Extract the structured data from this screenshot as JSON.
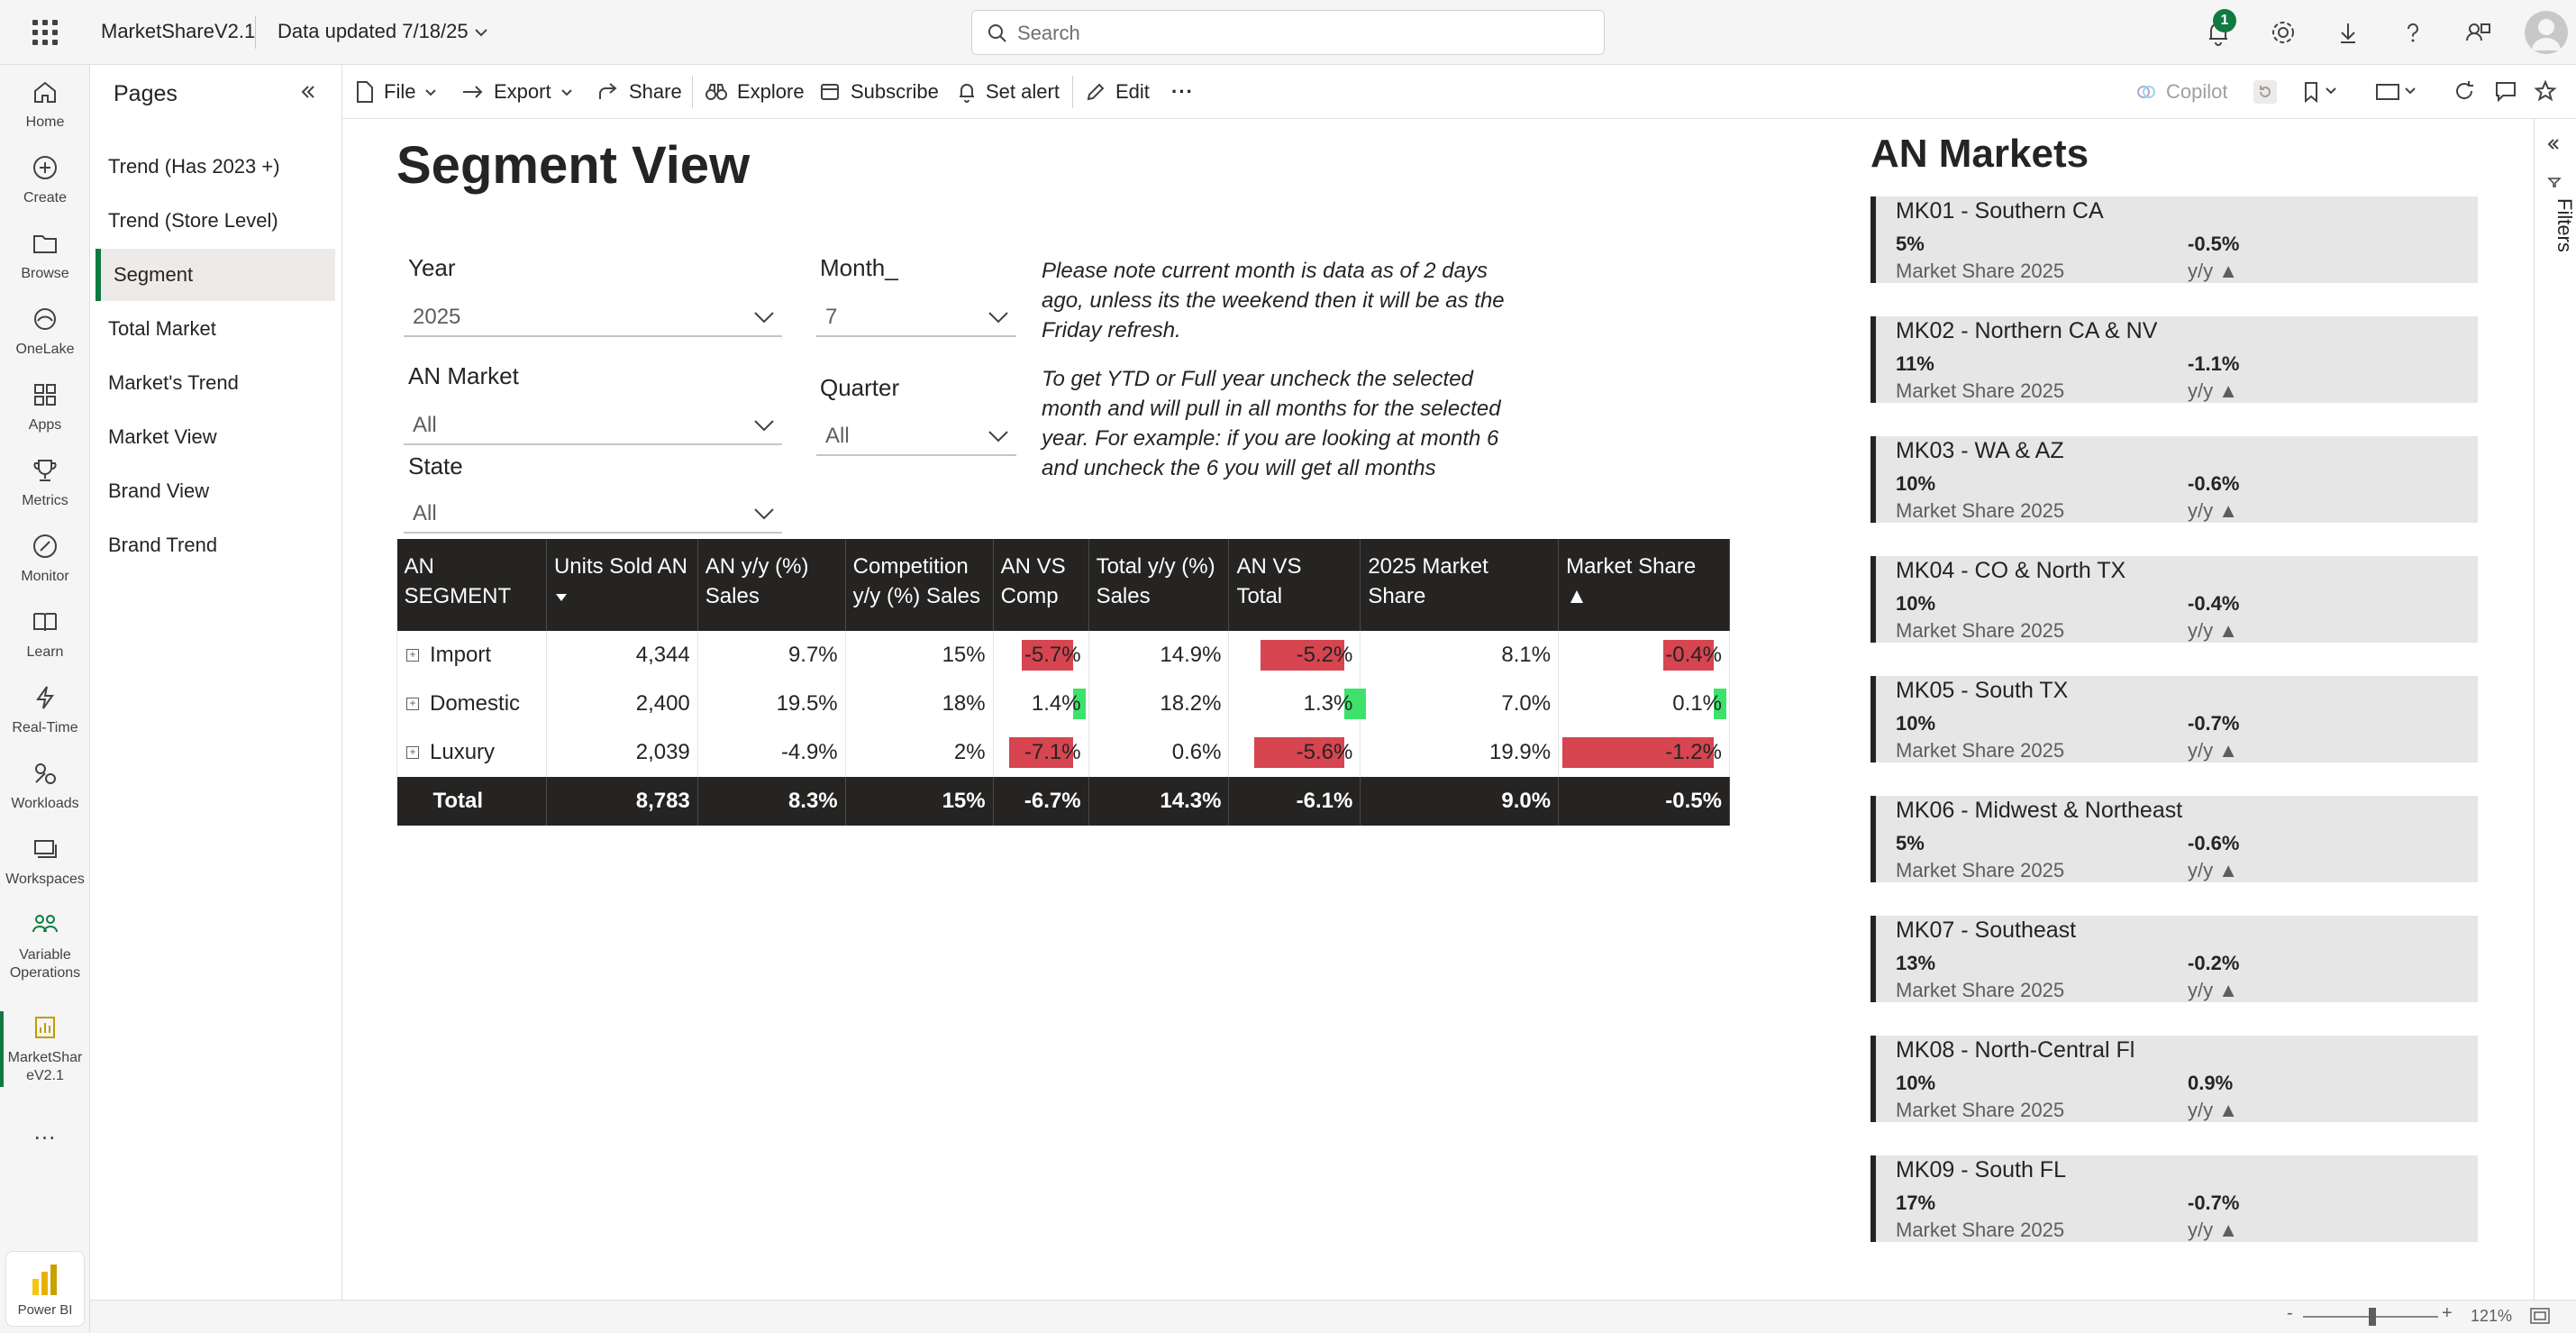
{
  "header": {
    "app_name": "MarketShareV2.1",
    "data_updated": "Data updated 7/18/25",
    "search_placeholder": "Search",
    "notification_count": "1"
  },
  "leftnav": {
    "items": [
      {
        "label": "Home",
        "icon": "home-icon"
      },
      {
        "label": "Create",
        "icon": "plus-circle-icon"
      },
      {
        "label": "Browse",
        "icon": "folder-icon"
      },
      {
        "label": "OneLake",
        "icon": "onelake-icon"
      },
      {
        "label": "Apps",
        "icon": "apps-icon"
      },
      {
        "label": "Metrics",
        "icon": "trophy-icon"
      },
      {
        "label": "Monitor",
        "icon": "monitor-icon"
      },
      {
        "label": "Learn",
        "icon": "book-icon"
      },
      {
        "label": "Real-Time",
        "icon": "lightning-icon"
      },
      {
        "label": "Workloads",
        "icon": "workloads-icon"
      },
      {
        "label": "Workspaces",
        "icon": "workspaces-icon"
      },
      {
        "label": "Variable Operations",
        "icon": "people-icon"
      },
      {
        "label": "MarketShareV2.1",
        "icon": "report-icon"
      }
    ],
    "more": "...",
    "powerbi_label": "Power BI"
  },
  "pages": {
    "title": "Pages",
    "items": [
      {
        "label": "Trend (Has 2023 +)"
      },
      {
        "label": "Trend (Store Level)"
      },
      {
        "label": "Segment"
      },
      {
        "label": "Total Market"
      },
      {
        "label": "Market's Trend"
      },
      {
        "label": "Market View"
      },
      {
        "label": "Brand View"
      },
      {
        "label": "Brand Trend"
      }
    ]
  },
  "toolbar": {
    "file": "File",
    "export": "Export",
    "share": "Share",
    "explore": "Explore",
    "subscribe": "Subscribe",
    "set_alert": "Set alert",
    "edit": "Edit",
    "more": "···",
    "copilot": "Copilot"
  },
  "report": {
    "title": "Segment View",
    "slicers": {
      "year": {
        "label": "Year",
        "value": "2025"
      },
      "month": {
        "label": "Month_",
        "value": "7"
      },
      "an_market": {
        "label": "AN Market",
        "value": "All"
      },
      "quarter": {
        "label": "Quarter",
        "value": "All"
      },
      "state": {
        "label": "State",
        "value": "All"
      }
    },
    "note1": "Please note current month is data as of 2 days ago, unless its the weekend then it will be as the Friday refresh.",
    "note2": "To get YTD or Full year uncheck the selected month and will pull in all months for the selected year. For example: if you are looking at month 6 and uncheck the 6 you will get all months"
  },
  "matrix": {
    "headers": [
      "AN SEGMENT",
      "Units Sold AN",
      "AN y/y (%) Sales",
      "Competition y/y (%) Sales",
      "AN VS Comp",
      "Total y/y (%) Sales",
      "AN VS Total",
      "2025 Market Share",
      "Market Share ▲"
    ],
    "rows": [
      {
        "segment": "Import",
        "units": "4,344",
        "an_yy": "9.7%",
        "comp_yy": "15%",
        "an_vs_comp": "-5.7%",
        "an_vs_comp_val": -5.7,
        "total_yy": "14.9%",
        "an_vs_total": "-5.2%",
        "an_vs_total_val": -5.2,
        "ms_2025": "8.1%",
        "ms_chg": "-0.4%",
        "ms_chg_val": -0.4
      },
      {
        "segment": "Domestic",
        "units": "2,400",
        "an_yy": "19.5%",
        "comp_yy": "18%",
        "an_vs_comp": "1.4%",
        "an_vs_comp_val": 1.4,
        "total_yy": "18.2%",
        "an_vs_total": "1.3%",
        "an_vs_total_val": 1.3,
        "ms_2025": "7.0%",
        "ms_chg": "0.1%",
        "ms_chg_val": 0.1
      },
      {
        "segment": "Luxury",
        "units": "2,039",
        "an_yy": "-4.9%",
        "comp_yy": "2%",
        "an_vs_comp": "-7.1%",
        "an_vs_comp_val": -7.1,
        "total_yy": "0.6%",
        "an_vs_total": "-5.6%",
        "an_vs_total_val": -5.6,
        "ms_2025": "19.9%",
        "ms_chg": "-1.2%",
        "ms_chg_val": -1.2
      }
    ],
    "total": {
      "segment": "Total",
      "units": "8,783",
      "an_yy": "8.3%",
      "comp_yy": "15%",
      "an_vs_comp": "-6.7%",
      "total_yy": "14.3%",
      "an_vs_total": "-6.1%",
      "ms_2025": "9.0%",
      "ms_chg": "-0.5%"
    },
    "colors": {
      "negative": "#d64550",
      "positive": "#3ee26a"
    }
  },
  "markets": {
    "title": "AN Markets",
    "cards": [
      {
        "name": "MK01 - Southern CA",
        "share": "5%",
        "share_label": "Market Share 2025",
        "yy": "-0.5%",
        "yy_label": "y/y ▲"
      },
      {
        "name": "MK02 - Northern CA & NV",
        "share": "11%",
        "share_label": "Market Share 2025",
        "yy": "-1.1%",
        "yy_label": "y/y ▲"
      },
      {
        "name": "MK03 - WA & AZ",
        "share": "10%",
        "share_label": "Market Share 2025",
        "yy": "-0.6%",
        "yy_label": "y/y ▲"
      },
      {
        "name": "MK04 - CO & North TX",
        "share": "10%",
        "share_label": "Market Share 2025",
        "yy": "-0.4%",
        "yy_label": "y/y ▲"
      },
      {
        "name": "MK05 - South TX",
        "share": "10%",
        "share_label": "Market Share 2025",
        "yy": "-0.7%",
        "yy_label": "y/y ▲"
      },
      {
        "name": "MK06 - Midwest & Northeast",
        "share": "5%",
        "share_label": "Market Share 2025",
        "yy": "-0.6%",
        "yy_label": "y/y ▲"
      },
      {
        "name": "MK07 - Southeast",
        "share": "13%",
        "share_label": "Market Share 2025",
        "yy": "-0.2%",
        "yy_label": "y/y ▲"
      },
      {
        "name": "MK08 - North-Central Fl",
        "share": "10%",
        "share_label": "Market Share 2025",
        "yy": "0.9%",
        "yy_label": "y/y ▲"
      },
      {
        "name": "MK09 - South FL",
        "share": "17%",
        "share_label": "Market Share 2025",
        "yy": "-0.7%",
        "yy_label": "y/y ▲"
      }
    ]
  },
  "filters": {
    "label": "Filters"
  },
  "status": {
    "zoom": "121%",
    "zoom_minus": "-",
    "zoom_plus": "+"
  }
}
